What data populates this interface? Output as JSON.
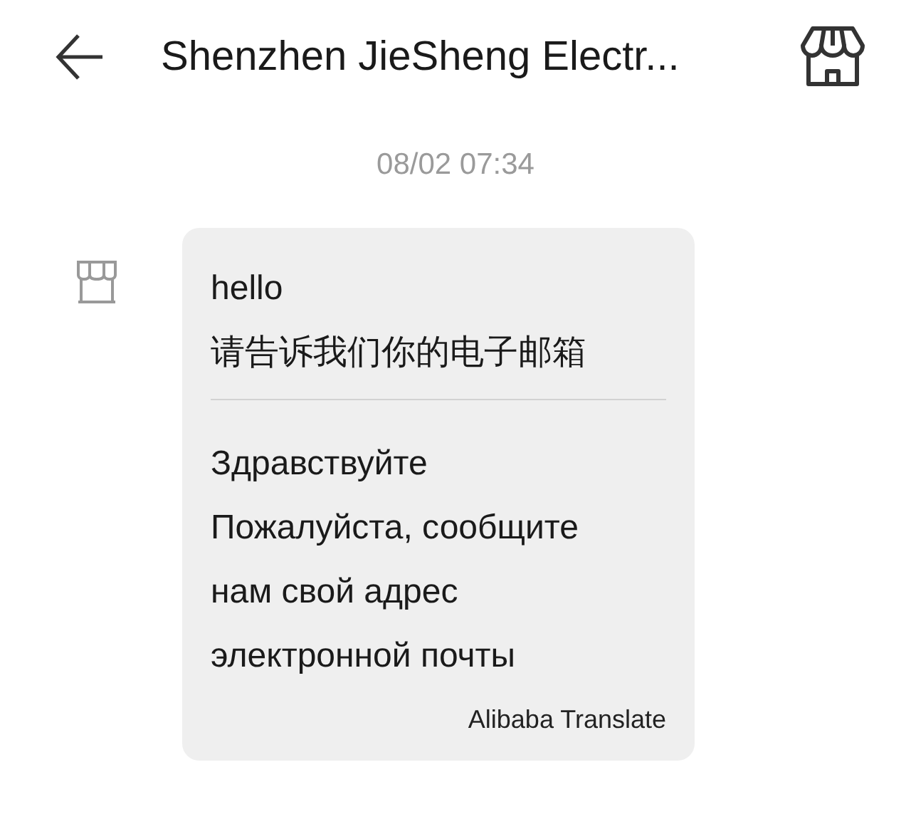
{
  "header": {
    "title": "Shenzhen JieSheng Electr..."
  },
  "timestamp": "08/02 07:34",
  "message": {
    "original": [
      "hello",
      "请告诉我们你的电子邮箱"
    ],
    "translation": [
      "Здравствуйте",
      "Пожалуйста, сообщите",
      "нам свой адрес",
      "электронной почты"
    ],
    "translator": "Alibaba Translate"
  }
}
